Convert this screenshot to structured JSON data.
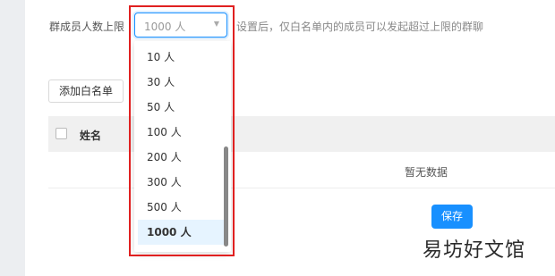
{
  "settings": {
    "limit_label": "群成员人数上限",
    "select_value": "1000 人",
    "description": "设置后，仅白名单内的成员可以发起超过上限的群聊",
    "options": [
      "10 人",
      "30 人",
      "50 人",
      "100 人",
      "200 人",
      "300 人",
      "500 人",
      "1000 人"
    ],
    "selected_option": "1000 人"
  },
  "whitelist": {
    "add_button": "添加白名单",
    "column_name": "姓名",
    "empty_text": "暂无数据"
  },
  "actions": {
    "save_button": "保存"
  },
  "watermark": "易坊好文馆",
  "colors": {
    "primary": "#1890ff",
    "highlight_frame": "#e02020"
  }
}
